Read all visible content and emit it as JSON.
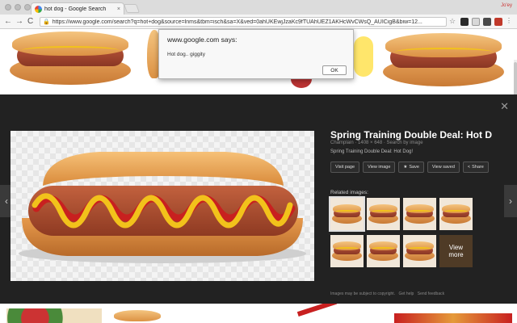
{
  "browser": {
    "tab_title": "hot dog - Google Search",
    "tab_close": "×",
    "profile": "Jo'ey",
    "url": "https://www.google.com/search?q=hot+dog&source=lnms&tbm=isch&sa=X&ved=0ahUKEwjJzaKc9fTUAhUEZ1AKHcWvCWsQ_AUICigB&biw=12...",
    "nav_back": "←",
    "nav_forward": "→",
    "nav_reload": "C",
    "lock_icon": "🔒",
    "star_icon": "☆"
  },
  "dialog": {
    "title": "www.google.com says:",
    "message": "Hot dog.. giggity",
    "ok_label": "OK"
  },
  "panel": {
    "close_label": "✕",
    "prev_label": "‹",
    "next_label": "›",
    "title": "Spring Training Double Deal: Hot Dog! ...",
    "meta": "Champlain · 1408 × 648 · Search by image",
    "description": "Spring Training Double Deal: Hot Dog!",
    "buttons": [
      {
        "label": "Visit page",
        "icon": ""
      },
      {
        "label": "View image",
        "icon": ""
      },
      {
        "label": "Save",
        "icon": "★"
      },
      {
        "label": "View saved",
        "icon": ""
      },
      {
        "label": "Share",
        "icon": "<"
      }
    ],
    "related_label": "Related images:",
    "view_more": "View\nmore",
    "footer_links": [
      "Images may be subject to copyright.",
      "Get help",
      "Send feedback"
    ]
  },
  "colors": {
    "panel_bg": "#222222",
    "mustard": "#f2c21b",
    "ketchup": "#c8201f"
  }
}
